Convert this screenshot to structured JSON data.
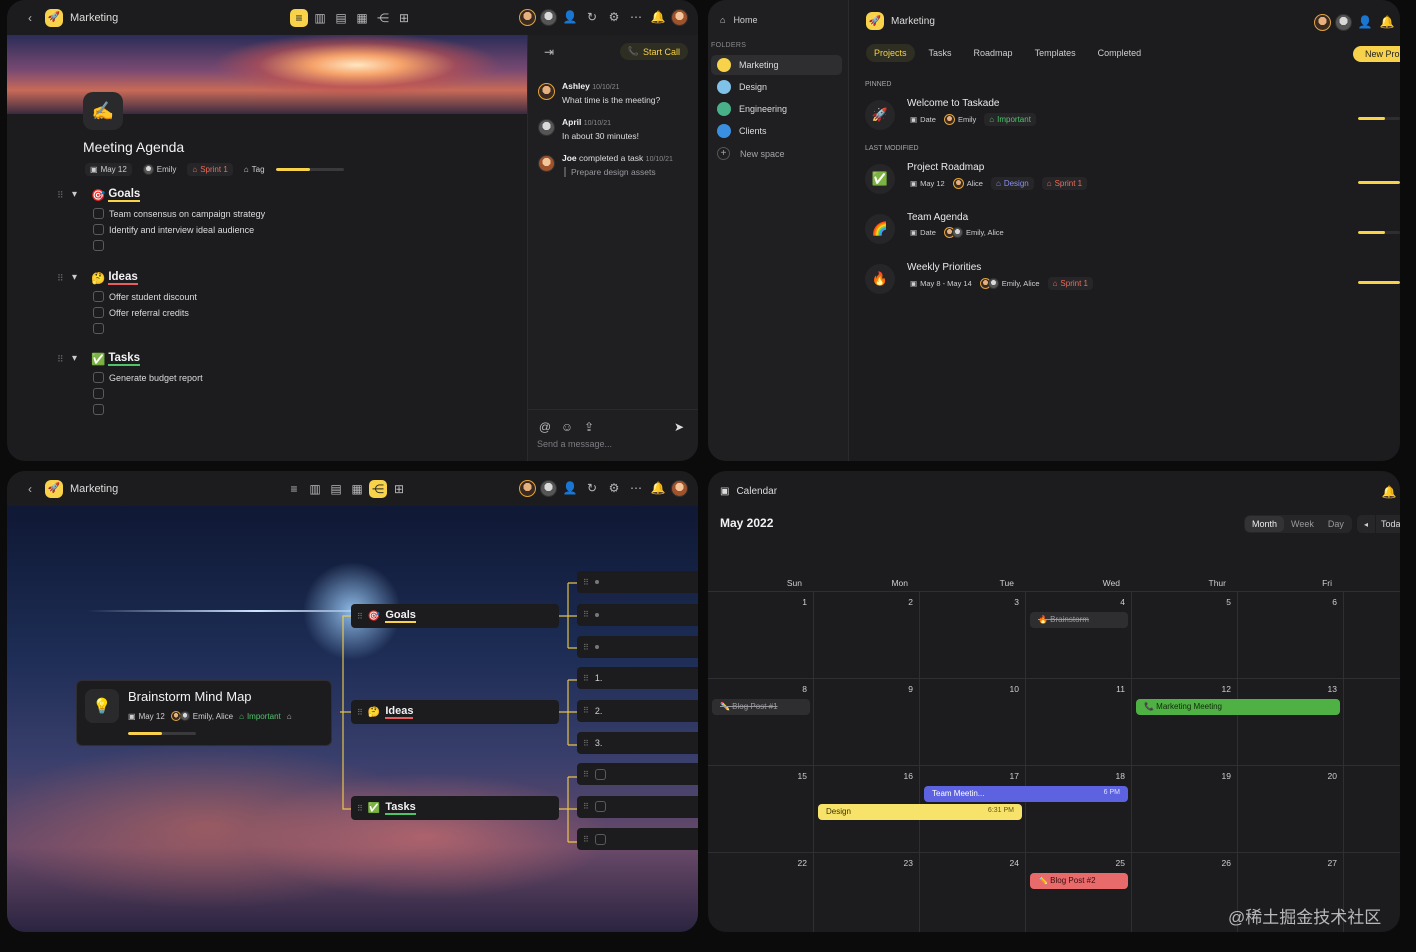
{
  "doc": {
    "space": "Marketing",
    "title": "Meeting Agenda",
    "meta": {
      "date": "May 12",
      "user": "Emily",
      "sprint": "Sprint 1",
      "tag": "Tag",
      "progress": 0.5
    },
    "sections": [
      {
        "emoji": "🎯",
        "title": "Goals",
        "underline": "#f7d24a",
        "items": [
          "Team consensus on campaign strategy",
          "Identify and interview ideal audience",
          ""
        ]
      },
      {
        "emoji": "🤔",
        "title": "Ideas",
        "underline": "#e85d5d",
        "items": [
          "Offer student discount",
          "Offer referral credits",
          ""
        ]
      },
      {
        "emoji": "✅",
        "title": "Tasks",
        "underline": "#4fc36a",
        "items": [
          "Generate budget report",
          "",
          ""
        ]
      }
    ],
    "chat": {
      "start_call": "Start Call",
      "messages": [
        {
          "name": "Ashley",
          "time": "10/10/21",
          "text": "What time is the meeting?"
        },
        {
          "name": "April",
          "time": "10/10/21",
          "text": "In about 30 minutes!"
        },
        {
          "name": "Joe",
          "action": "completed a task",
          "time": "10/10/21",
          "text": "Prepare design assets"
        }
      ],
      "placeholder": "Send a message..."
    }
  },
  "projects": {
    "home": "Home",
    "folders_label": "FOLDERS",
    "folders": [
      {
        "name": "Marketing",
        "color": "#f7d24a"
      },
      {
        "name": "Design",
        "color": "#7fc1e8"
      },
      {
        "name": "Engineering",
        "color": "#49b18a"
      },
      {
        "name": "Clients",
        "color": "#3b8fe0"
      }
    ],
    "new_space": "New space",
    "space": "Marketing",
    "tabs": [
      "Projects",
      "Tasks",
      "Roadmap",
      "Templates",
      "Completed"
    ],
    "new_button": "New Pro",
    "pinned_label": "PINNED",
    "last_label": "LAST MODIFIED",
    "pinned": [
      {
        "icon": "🚀",
        "name": "Welcome to Taskade",
        "date": "Date",
        "users": "Emily",
        "tags": [
          {
            "label": "Important",
            "kind": "green"
          }
        ],
        "progress": 0.65
      }
    ],
    "recent": [
      {
        "icon": "✅",
        "name": "Project Roadmap",
        "date": "May 12",
        "users": "Alice",
        "tags": [
          {
            "label": "Design",
            "kind": "blue"
          },
          {
            "label": "Sprint 1",
            "kind": "red"
          }
        ],
        "progress": 1
      },
      {
        "icon": "🌈",
        "name": "Team Agenda",
        "date": "Date",
        "users": "Emily, Alice",
        "tags": [],
        "progress": 0.65
      },
      {
        "icon": "🔥",
        "name": "Weekly Priorities",
        "date": "May 8 - May 14",
        "users": "Emily, Alice",
        "tags": [
          {
            "label": "Sprint 1",
            "kind": "red"
          }
        ],
        "progress": 1
      }
    ]
  },
  "mindmap": {
    "space": "Marketing",
    "root": {
      "title": "Brainstorm Mind Map",
      "date": "May 12",
      "users": "Emily, Alice",
      "tag": "Important",
      "progress": 0.5
    },
    "branches": [
      {
        "emoji": "🎯",
        "title": "Goals",
        "underline": "#f7d24a",
        "children": [
          "",
          "",
          ""
        ]
      },
      {
        "emoji": "🤔",
        "title": "Ideas",
        "underline": "#e85d5d",
        "children": [
          "1.",
          "2.",
          "3."
        ]
      },
      {
        "emoji": "✅",
        "title": "Tasks",
        "underline": "#4fc36a",
        "children": [
          "",
          "",
          ""
        ]
      }
    ]
  },
  "calendar": {
    "title": "Calendar",
    "month": "May 2022",
    "views": [
      "Month",
      "Week",
      "Day"
    ],
    "today": "Toda",
    "weekdays": [
      "Sun",
      "Mon",
      "Tue",
      "Wed",
      "Thur",
      "Fri"
    ],
    "weeks": [
      [
        1,
        2,
        3,
        4,
        5,
        6
      ],
      [
        8,
        9,
        10,
        11,
        12,
        13
      ],
      [
        15,
        16,
        17,
        18,
        19,
        20
      ],
      [
        22,
        23,
        24,
        25,
        26,
        27
      ]
    ],
    "events": [
      {
        "label": "🔥 Brainstorm",
        "week": 0,
        "start": 3,
        "span": 1,
        "color": "#2e2e31",
        "text": "#9a9a9e",
        "strike": true,
        "time": ""
      },
      {
        "label": "✏️ Blog Post #1",
        "week": 1,
        "start": 0,
        "span": 1,
        "color": "#2e2e31",
        "text": "#9a9a9e",
        "strike": true,
        "time": ""
      },
      {
        "label": "📞 Marketing Meeting",
        "week": 1,
        "start": 4,
        "span": 2,
        "color": "#4fb043",
        "text": "#0f2a0c",
        "strike": false,
        "time": ""
      },
      {
        "label": "Team Meetin...",
        "week": 2,
        "start": 2,
        "span": 2,
        "color": "#5d63e0",
        "text": "#ffffff",
        "strike": false,
        "time": "6 PM"
      },
      {
        "label": "Design",
        "week": 2,
        "start": 1,
        "span": 2,
        "color": "#f7e36a",
        "text": "#3a3300",
        "strike": false,
        "time": "6:31 PM"
      },
      {
        "label": "✏️ Blog Post #2",
        "week": 3,
        "start": 3,
        "span": 1,
        "color": "#e86a6a",
        "text": "#3a0d0d",
        "strike": false,
        "time": ""
      }
    ]
  },
  "watermark": "@稀土掘金技术社区"
}
